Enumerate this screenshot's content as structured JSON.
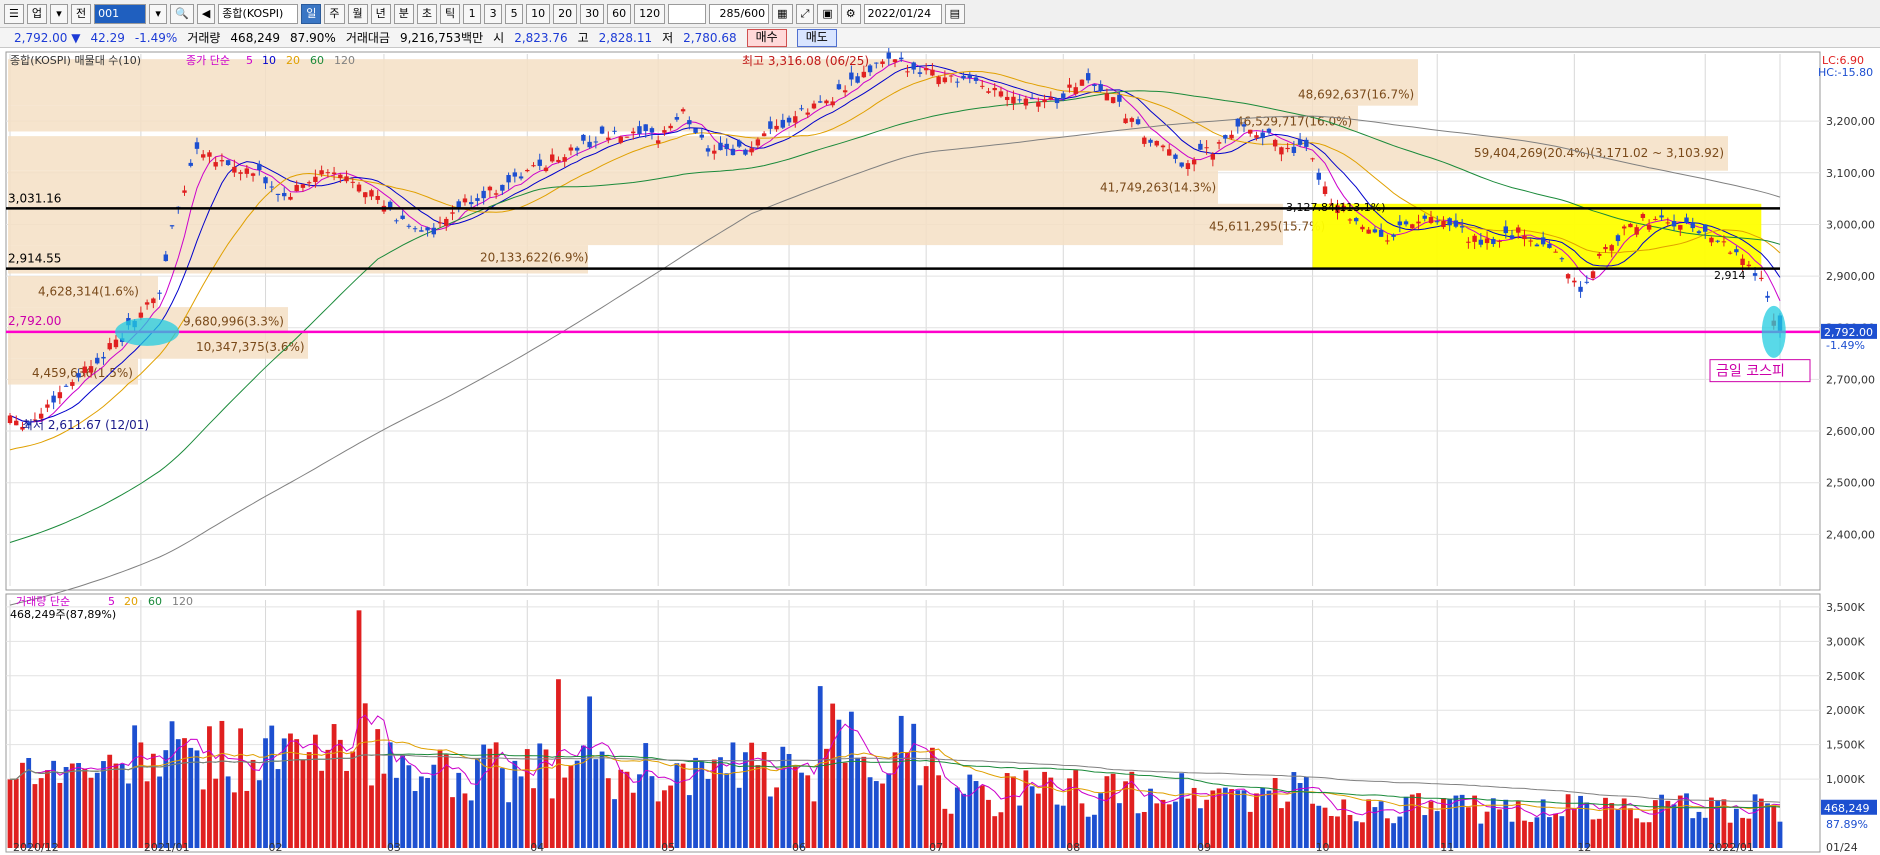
{
  "toolbar": {
    "type_label": "업",
    "mode_label": "전",
    "code": "001",
    "name": "종합(KOSPI)",
    "periods": [
      "일",
      "주",
      "월",
      "년",
      "분",
      "초",
      "틱"
    ],
    "active_period": "일",
    "intervals": [
      "1",
      "3",
      "5",
      "10",
      "20",
      "30",
      "60",
      "120"
    ],
    "count": "285/600",
    "date": "2022/01/24"
  },
  "infobar": {
    "price": "2,792.00 ▼",
    "change": "42.29",
    "change_pct": "-1.49%",
    "volume_label": "거래량",
    "volume": "468,249",
    "volume_pct": "87.90%",
    "amount_label": "거래대금",
    "amount": "9,216,753백만",
    "open_label": "시",
    "open": "2,823.76",
    "high_label": "고",
    "high": "2,828.11",
    "low_label": "저",
    "low": "2,780.68",
    "buy": "매수",
    "sell": "매도"
  },
  "price_legend": {
    "title": "종합(KOSPI) 매물대 수(10)",
    "ma_label": "종가 단순",
    "ma": [
      {
        "label": "5",
        "color": "#cc00cc"
      },
      {
        "label": "10",
        "color": "#0000cc"
      },
      {
        "label": "20",
        "color": "#e0a000"
      },
      {
        "label": "60",
        "color": "#1a8a3a"
      },
      {
        "label": "120",
        "color": "#808080"
      }
    ]
  },
  "volume_legend": {
    "title": "거래량 단순",
    "ma": [
      {
        "label": "5",
        "color": "#cc00cc"
      },
      {
        "label": "20",
        "color": "#e0a000"
      },
      {
        "label": "60",
        "color": "#1a8a3a"
      },
      {
        "label": "120",
        "color": "#808080"
      }
    ],
    "value": "468,249주(87,89%)"
  },
  "right_labels": {
    "lc": "LC:6.90",
    "hc": "HC:-15.80",
    "price_tag": "2,792.00",
    "pct_tag": "-1.49%",
    "vol_tag": "468,249",
    "vol_pct_tag": "87.89%"
  },
  "lines": {
    "upper_value": "3,031.16",
    "lower_value": "2,914.55",
    "current_value": "2,792.00",
    "end_label": "2,914"
  },
  "annotations": {
    "high": "최고 3,316.08 (06/25)",
    "low": "최저 2,611.67 (12/01)",
    "mid": "3,127.84(113.1%)",
    "today": "금일 코스피"
  },
  "volume_profile": [
    {
      "label": "48,692,637(16.7%)"
    },
    {
      "label": "46,529,717(16.0%)"
    },
    {
      "label": "59,404,269(20.4%)(3,171.02 ~ 3,103.92)"
    },
    {
      "label": "41,749,263(14.3%)"
    },
    {
      "label": "45,611,295(15.7%)"
    },
    {
      "label": "20,133,622(6.9%)"
    },
    {
      "label": "4,628,314(1.6%)"
    },
    {
      "label": "9,680,996(3.3%)"
    },
    {
      "label": "10,347,375(3.6%)"
    },
    {
      "label": "4,459,636(1.5%)"
    }
  ],
  "chart_data": {
    "type": "candlestick",
    "price_axis": {
      "min": 2300,
      "max": 3330,
      "ticks": [
        "3,200,00",
        "3,100,00",
        "3,000,00",
        "2,900,00",
        "2,800,00",
        "2,700,00",
        "2,600,00",
        "2,500,00",
        "2,400,00"
      ]
    },
    "volume_axis": {
      "unit": "K",
      "ticks": [
        "3,500K",
        "3,000K",
        "2,500K",
        "2,000K",
        "1,500K",
        "1,000K"
      ]
    },
    "x_labels": [
      "2020/12",
      "2021/01",
      "02",
      "03",
      "04",
      "05",
      "06",
      "07",
      "08",
      "09",
      "10",
      "11",
      "12",
      "2022/01",
      "01/24"
    ],
    "monthly_close": [
      {
        "month": "2020/12",
        "close": 2873
      },
      {
        "month": "2021/01",
        "close": 2976
      },
      {
        "month": "02",
        "close": 3013
      },
      {
        "month": "03",
        "close": 3061
      },
      {
        "month": "04",
        "close": 3147
      },
      {
        "month": "05",
        "close": 3203
      },
      {
        "month": "06",
        "close": 3296
      },
      {
        "month": "07",
        "close": 3202
      },
      {
        "month": "08",
        "close": 3199
      },
      {
        "month": "09",
        "close": 3068
      },
      {
        "month": "10",
        "close": 2970
      },
      {
        "month": "11",
        "close": 2839
      },
      {
        "month": "12",
        "close": 2977
      },
      {
        "month": "2022/01",
        "close": 2792
      }
    ],
    "key_points": {
      "high": 3316.08,
      "low": 2611.67,
      "last": 2792.0
    }
  }
}
